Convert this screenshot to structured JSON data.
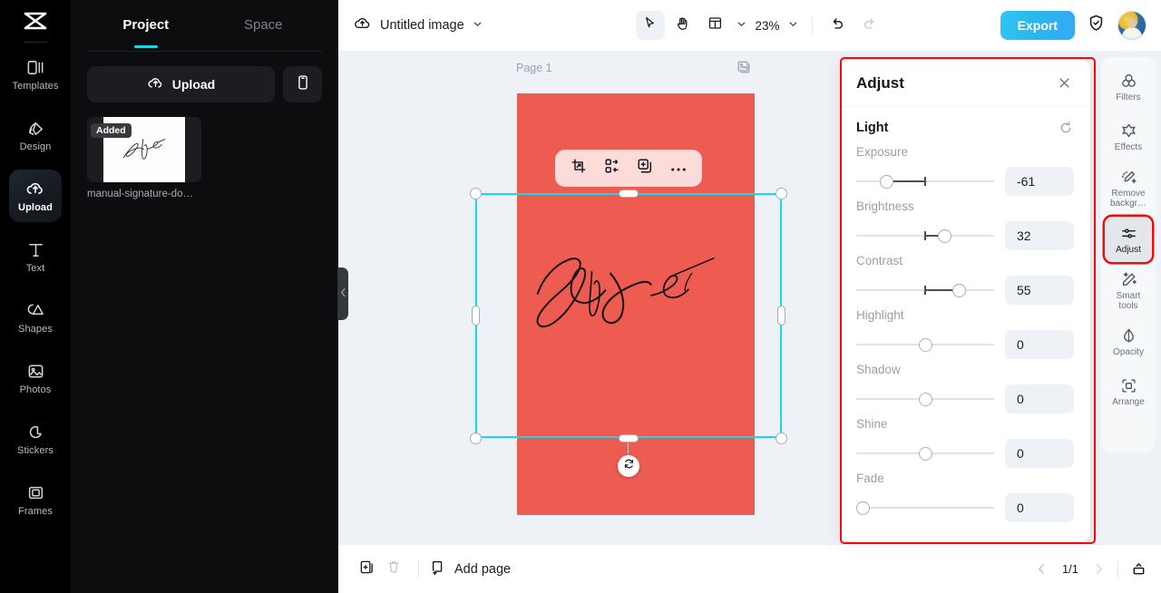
{
  "app": {
    "logo_icon": "capcut-logo-icon",
    "accent_cyan": "#22d2df",
    "selection_cyan": "#17d6ef",
    "artboard_color": "#ee5b51",
    "highlight_red": "#f00c0c",
    "export_blue": "#29b6ef"
  },
  "rail": {
    "items": [
      {
        "label": "Templates",
        "icon": "templates-icon",
        "active": false
      },
      {
        "label": "Design",
        "icon": "design-icon",
        "active": false
      },
      {
        "label": "Upload",
        "icon": "upload-cloud-icon",
        "active": true
      },
      {
        "label": "Text",
        "icon": "text-icon",
        "active": false
      },
      {
        "label": "Shapes",
        "icon": "shapes-icon",
        "active": false
      },
      {
        "label": "Photos",
        "icon": "photos-icon",
        "active": false
      },
      {
        "label": "Stickers",
        "icon": "stickers-icon",
        "active": false
      },
      {
        "label": "Frames",
        "icon": "frames-icon",
        "active": false
      }
    ]
  },
  "panel": {
    "tabs": [
      {
        "label": "Project",
        "active": true
      },
      {
        "label": "Space",
        "active": false
      }
    ],
    "upload_label": "Upload",
    "upload_icon": "upload-cloud-icon",
    "mobile_icon": "mobile-phone-icon",
    "asset": {
      "badge": "Added",
      "name": "manual-signature-do…"
    },
    "collapse_icon": "chevron-left-icon"
  },
  "topbar": {
    "cloud_icon": "cloud-save-icon",
    "title": "Untitled image",
    "title_chevron_icon": "chevron-down-icon",
    "tools": [
      {
        "name": "select-tool",
        "icon": "cursor-arrow-icon",
        "active": true
      },
      {
        "name": "hand-tool",
        "icon": "hand-icon",
        "active": false
      },
      {
        "name": "layout-tool",
        "icon": "layout-grid-icon",
        "active": false
      }
    ],
    "layout_chevron_icon": "chevron-down-icon",
    "zoom_level": "23%",
    "zoom_chevron_icon": "chevron-down-icon",
    "undo_icon": "undo-arrow-icon",
    "redo_icon": "redo-arrow-icon",
    "export_label": "Export",
    "shield_icon": "shield-check-icon",
    "avatar_icon": "user-avatar"
  },
  "canvas": {
    "page_label": "Page 1",
    "page_duplicate_icon": "duplicate-page-icon",
    "float_toolbar": [
      {
        "name": "crop-button",
        "icon": "crop-icon"
      },
      {
        "name": "replace-button",
        "icon": "swap-replace-icon"
      },
      {
        "name": "duplicate-button",
        "icon": "duplicate-icon"
      },
      {
        "name": "more-button",
        "icon": "more-dots-icon"
      }
    ],
    "rotate_icon": "rotate-icon"
  },
  "bottombar": {
    "duplicate_icon": "duplicate-page-icon",
    "delete_icon": "trash-icon",
    "add_page_label": "Add page",
    "add_page_icon": "add-page-icon",
    "prev_icon": "chevron-left-icon",
    "page_indicator": "1/1",
    "next_icon": "chevron-right-icon",
    "collapse_icon": "collapse-panel-icon"
  },
  "adjust": {
    "title": "Adjust",
    "close_icon": "close-x-icon",
    "section": {
      "title": "Light",
      "reset_icon": "reset-circular-arrow-icon"
    },
    "controls": [
      {
        "label": "Exposure",
        "value": "-61",
        "pos": 19,
        "tick": 50,
        "mode": "from-tick"
      },
      {
        "label": "Brightness",
        "value": "32",
        "pos": 66,
        "tick": 50,
        "mode": "from-tick"
      },
      {
        "label": "Contrast",
        "value": "55",
        "pos": 77.5,
        "tick": 50,
        "mode": "from-tick"
      },
      {
        "label": "Highlight",
        "value": "0",
        "pos": 50,
        "tick": null,
        "mode": "none"
      },
      {
        "label": "Shadow",
        "value": "0",
        "pos": 50,
        "tick": null,
        "mode": "none"
      },
      {
        "label": "Shine",
        "value": "0",
        "pos": 50,
        "tick": null,
        "mode": "none"
      },
      {
        "label": "Fade",
        "value": "0",
        "pos": 0,
        "tick": null,
        "mode": "none"
      }
    ]
  },
  "tool_rail": {
    "items": [
      {
        "label": "Filters",
        "icon": "filters-circles-icon",
        "active": false
      },
      {
        "label": "Effects",
        "icon": "effects-star-icon",
        "active": false
      },
      {
        "label": "Remove\nbackgr…",
        "icon": "remove-background-icon",
        "active": false
      },
      {
        "label": "Adjust",
        "icon": "adjust-sliders-icon",
        "active": true
      },
      {
        "label": "Smart\ntools",
        "icon": "smart-tools-wand-icon",
        "active": false
      },
      {
        "label": "Opacity",
        "icon": "opacity-droplet-icon",
        "active": false
      },
      {
        "label": "Arrange",
        "icon": "arrange-icon",
        "active": false
      }
    ]
  }
}
